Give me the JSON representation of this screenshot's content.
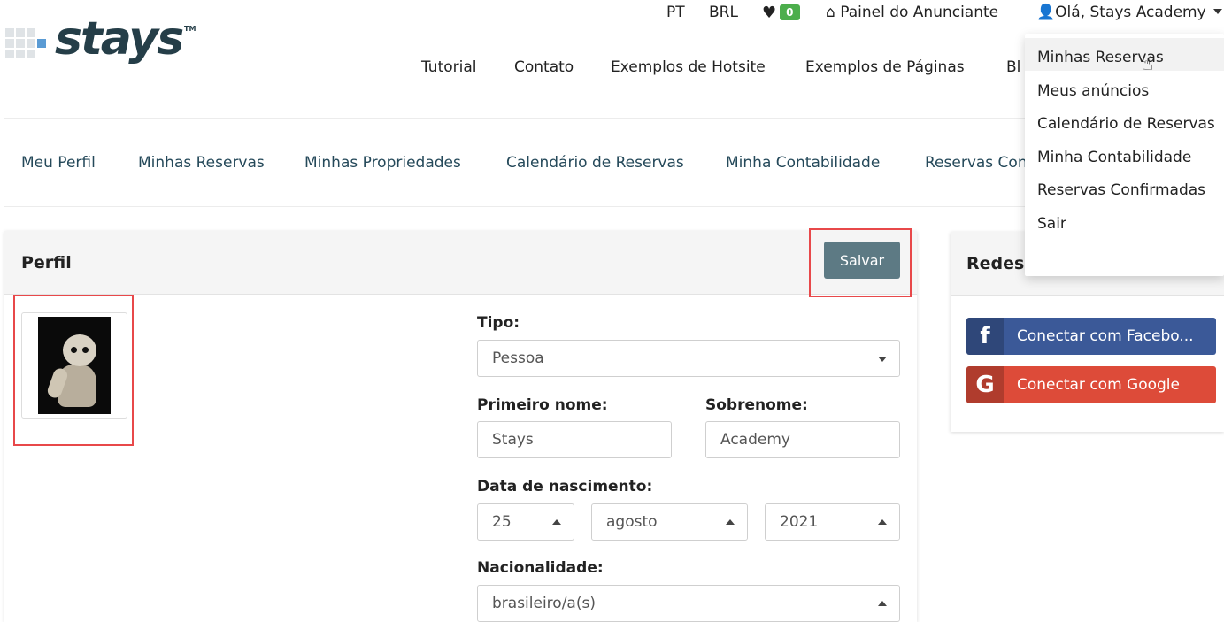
{
  "logo": {
    "text": "stays",
    "tm": "TM"
  },
  "topbar": {
    "lang": "PT",
    "currency": "BRL",
    "favorites_count": "0",
    "owner_panel": "Painel do Anunciante",
    "user_greeting": "Olá, Stays Academy"
  },
  "main_nav": [
    "Tutorial",
    "Contato",
    "Exemplos de Hotsite",
    "Exemplos de Páginas",
    "Bl"
  ],
  "sub_nav": [
    "Meu Perfil",
    "Minhas Reservas",
    "Minhas Propriedades",
    "Calendário de Reservas",
    "Minha Contabilidade",
    "Reservas Con"
  ],
  "user_menu": [
    "Minhas Reservas",
    "Meus anúncios",
    "Calendário de Reservas",
    "Minha Contabilidade",
    "Reservas Confirmadas",
    "Sair"
  ],
  "profile": {
    "title": "Perfil",
    "save_label": "Salvar",
    "type_label": "Tipo:",
    "type_value": "Pessoa",
    "first_name_label": "Primeiro nome:",
    "first_name_value": "Stays",
    "last_name_label": "Sobrenome:",
    "last_name_value": "Academy",
    "birth_label": "Data de nascimento:",
    "birth_day": "25",
    "birth_month": "agosto",
    "birth_year": "2021",
    "nationality_label": "Nacionalidade:",
    "nationality_value": "brasileiro/a(s)"
  },
  "social": {
    "title": "Redes",
    "facebook_label": "Conectar com Facebo...",
    "google_label": "Conectar com Google"
  },
  "colors": {
    "brand_dark": "#253e48",
    "save_button": "#5d7a84",
    "facebook": "#3b5998",
    "google": "#dd4b39",
    "highlight": "#e8484a",
    "badge": "#4cae4c"
  }
}
